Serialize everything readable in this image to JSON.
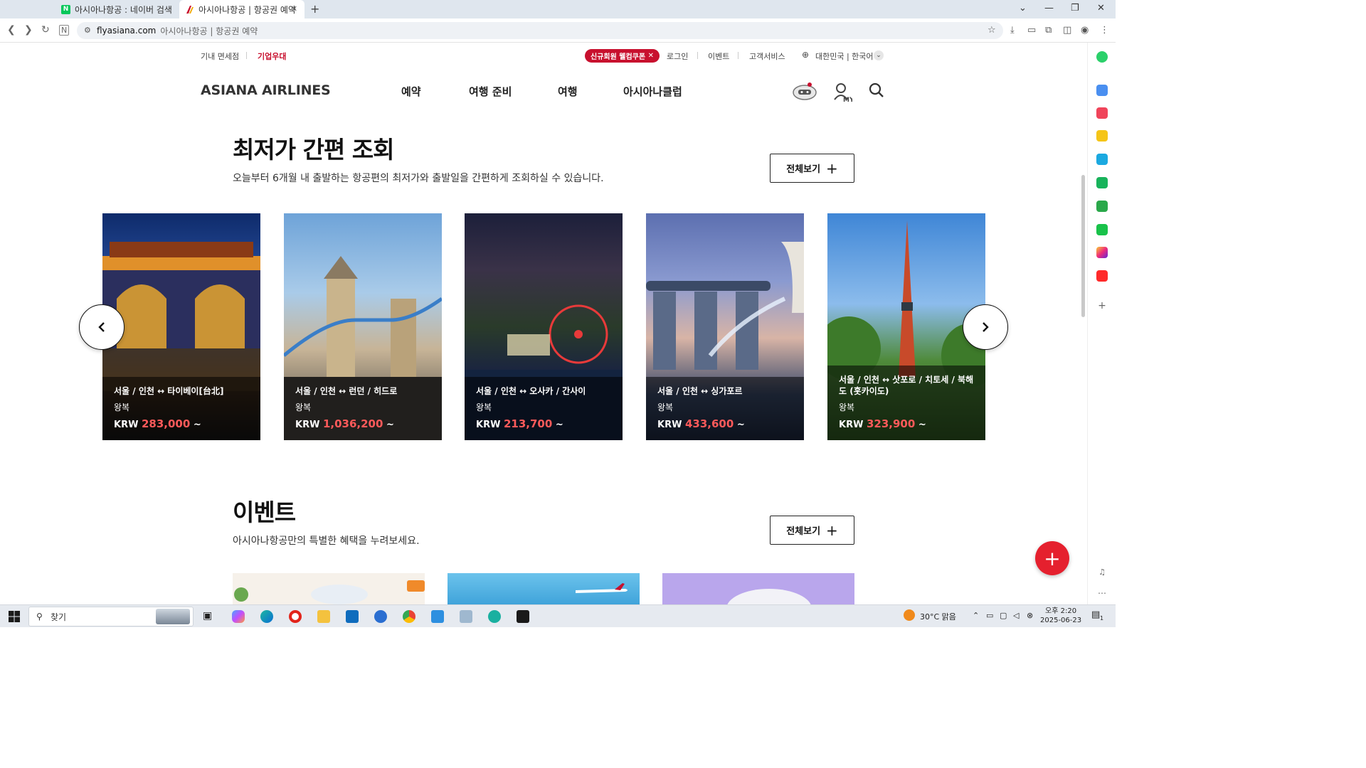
{
  "browser": {
    "tabs": [
      {
        "title": "아시아나항공 : 네이버 검색",
        "favicon": "N"
      },
      {
        "title": "아시아나항공 | 항공권 예약",
        "favicon": "asiana-icon"
      }
    ],
    "address": {
      "host": "flyasiana.com",
      "page_title": "아시아나항공 | 항공권 예약"
    }
  },
  "util_nav": {
    "duty_free": "기내 면세점",
    "corporate": "기업우대",
    "coupon": "신규회원 웰컴쿠폰",
    "login": "로그인",
    "event": "이벤트",
    "customer_service": "고객서비스",
    "locale": "대한민국 | 한국어"
  },
  "header": {
    "logo": "ASIANA AIRLINES",
    "menu": [
      "예약",
      "여행 준비",
      "여행",
      "아시아나클럽"
    ]
  },
  "lowest_fare": {
    "title": "최저가 간편 조회",
    "description": "오늘부터 6개월 내 출발하는 항공편의 최저가와 출발일을 간편하게 조회하실 수 있습니다.",
    "view_all": "전체보기",
    "cards": [
      {
        "route": "서울 / 인천 ↔ 타이베이[台北]",
        "trip": "왕복",
        "currency": "KRW",
        "price": "283,000",
        "suffix": "~"
      },
      {
        "route": "서울 / 인천 ↔ 런던 / 히드로",
        "trip": "왕복",
        "currency": "KRW",
        "price": "1,036,200",
        "suffix": "~"
      },
      {
        "route": "서울 / 인천 ↔ 오사카 / 간사이",
        "trip": "왕복",
        "currency": "KRW",
        "price": "213,700",
        "suffix": "~"
      },
      {
        "route": "서울 / 인천 ↔ 싱가포르",
        "trip": "왕복",
        "currency": "KRW",
        "price": "433,600",
        "suffix": "~"
      },
      {
        "route": "서울 / 인천 ↔ 삿포로 / 치토세 / 북해도 (홋카이도)",
        "trip": "왕복",
        "currency": "KRW",
        "price": "323,900",
        "suffix": "~"
      }
    ]
  },
  "events": {
    "title": "이벤트",
    "description": "아시아나항공만의 특별한 혜택을 누려보세요.",
    "view_all": "전체보기"
  },
  "taskbar": {
    "search_placeholder": "찾기",
    "weather": "30°C  맑음",
    "time": "오후 2:20",
    "date": "2025-06-23",
    "notifications": "1"
  },
  "colors": {
    "brand_red": "#c8102e",
    "price_red": "#ff5a5a",
    "fab_red": "#e5202e"
  }
}
